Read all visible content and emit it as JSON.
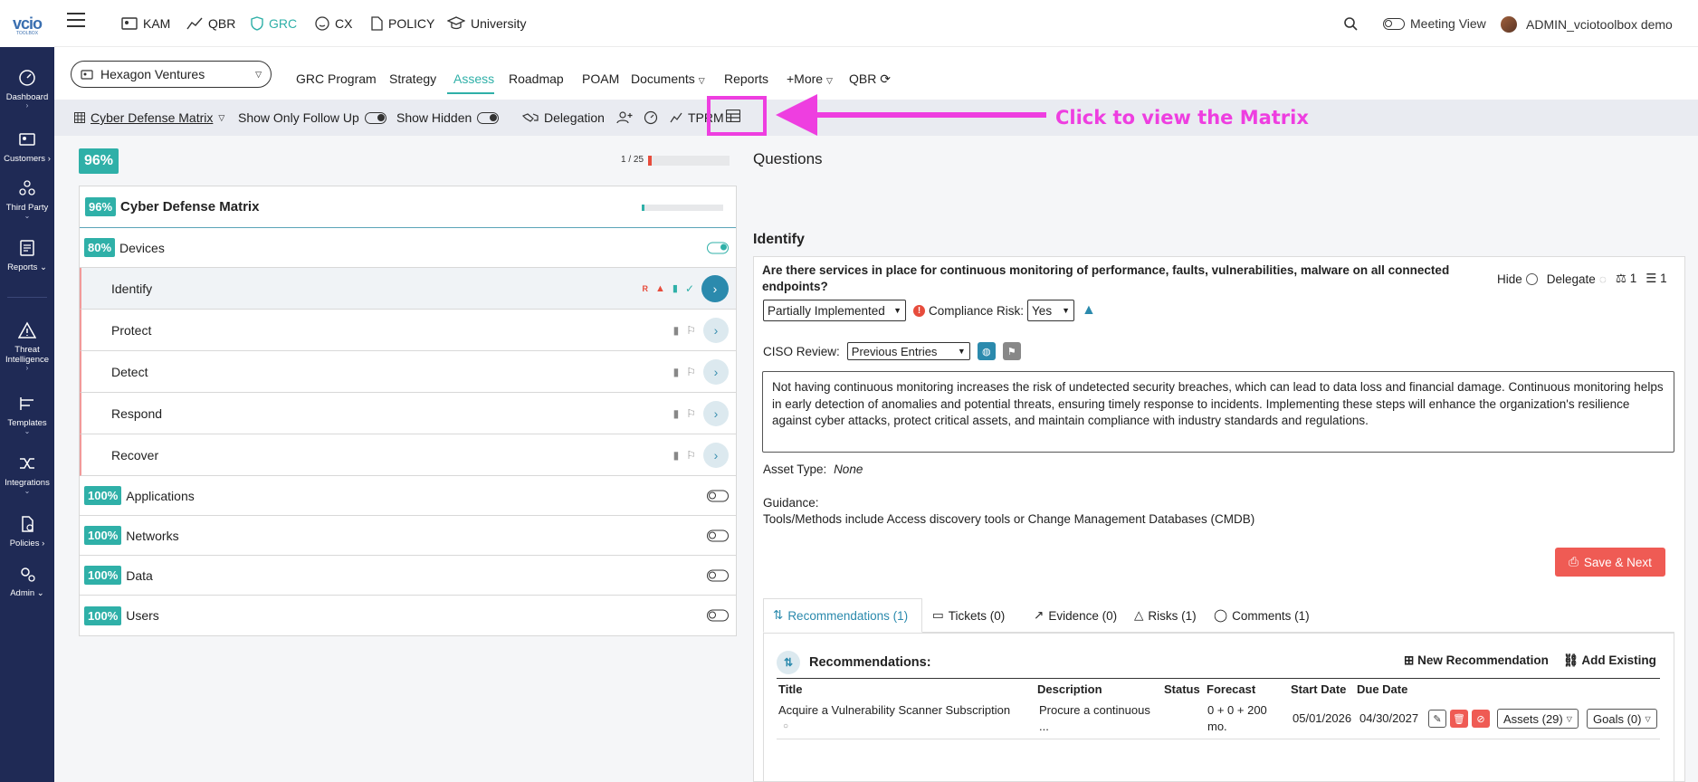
{
  "brand": {
    "logo": "vcio",
    "logo_sub": "TOOLBOX",
    "accent": "#2fb0a8",
    "sidebar_bg": "#1f2a55",
    "annotation": "#ee3ee0"
  },
  "sidebar": {
    "items": [
      {
        "label": "Dashboard",
        "icon": "dashboard-icon"
      },
      {
        "label": "Customers",
        "icon": "customers-icon"
      },
      {
        "label": "Third Party",
        "icon": "third-party-icon"
      },
      {
        "label": "Reports",
        "icon": "reports-icon"
      },
      {
        "label": "Threat Intelligence",
        "icon": "threat-icon"
      },
      {
        "label": "Templates",
        "icon": "templates-icon"
      },
      {
        "label": "Integrations",
        "icon": "integrations-icon"
      },
      {
        "label": "Policies",
        "icon": "policies-icon"
      },
      {
        "label": "Admin",
        "icon": "admin-icon"
      }
    ]
  },
  "topnav": {
    "items": [
      {
        "label": "KAM",
        "icon": "kam-icon"
      },
      {
        "label": "QBR",
        "icon": "chart-icon"
      },
      {
        "label": "GRC",
        "icon": "shield-icon"
      },
      {
        "label": "CX",
        "icon": "smile-icon"
      },
      {
        "label": "POLICY",
        "icon": "document-icon"
      },
      {
        "label": "University",
        "icon": "graduation-icon"
      }
    ],
    "meeting_view": "Meeting View",
    "user": "ADMIN_vciotoolbox demo"
  },
  "company": "Hexagon Ventures",
  "subtabs": [
    "GRC Program",
    "Strategy",
    "Assess",
    "Roadmap",
    "POAM",
    "Documents",
    "Reports",
    "+More",
    "QBR"
  ],
  "toolbar": {
    "matrix_select": "Cyber Defense Matrix",
    "follow_up": "Show Only Follow Up",
    "show_hidden": "Show Hidden",
    "delegation": "Delegation",
    "tprm": "TPRM",
    "callout": "Click to view the Matrix"
  },
  "overview": {
    "percent": "96%",
    "progress_label": "1 / 25",
    "progress": 0.04
  },
  "matrix": {
    "title": "Cyber Defense Matrix",
    "title_pct": "96%",
    "categories": [
      {
        "pct": "80%",
        "label": "Devices"
      },
      {
        "pct": "100%",
        "label": "Applications"
      },
      {
        "pct": "100%",
        "label": "Networks"
      },
      {
        "pct": "100%",
        "label": "Data"
      },
      {
        "pct": "100%",
        "label": "Users"
      }
    ],
    "functions": [
      "Identify",
      "Protect",
      "Detect",
      "Respond",
      "Recover"
    ]
  },
  "questions": {
    "heading": "Questions",
    "section": "Identify",
    "question": "Are there services in place for continuous monitoring of performance, faults, vulnerabilities, malware on all connected endpoints?",
    "hide": "Hide",
    "delegate": "Delegate",
    "count_a": "1",
    "count_b": "1",
    "status_value": "Partially Implemented",
    "compliance_label": "Compliance Risk:",
    "compliance_value": "Yes",
    "ciso_label": "CISO Review:",
    "ciso_value": "Previous Entries",
    "answer": "Not having continuous monitoring increases the risk of undetected security breaches, which can lead to data loss and financial damage. Continuous monitoring helps in early detection of anomalies and potential threats, ensuring timely response to incidents. Implementing these steps will enhance the organization's resilience against cyber attacks, protect critical assets, and maintain compliance with industry standards and regulations.",
    "asset_type_label": "Asset Type:",
    "asset_type_value": "None",
    "guidance_label": "Guidance:",
    "guidance_text": "Tools/Methods include Access discovery tools or Change Management Databases (CMDB)",
    "save_next": "Save & Next"
  },
  "tabs": [
    "Recommendations (1)",
    "Tickets (0)",
    "Evidence (0)",
    "Risks (1)",
    "Comments (1)"
  ],
  "recommendations": {
    "title": "Recommendations:",
    "new": "New Recommendation",
    "existing": "Add Existing",
    "headers": [
      "Title",
      "Description",
      "Status",
      "Forecast",
      "Start Date",
      "Due Date"
    ],
    "rows": [
      {
        "title": "Acquire a Vulnerability Scanner Subscription",
        "description": "Procure a continuous",
        "description_more": "...",
        "forecast": "0 + 0 + 200",
        "forecast_unit": "mo.",
        "start": "05/01/2026",
        "due": "04/30/2027",
        "assets": "Assets (29)",
        "goals": "Goals (0)"
      }
    ]
  }
}
